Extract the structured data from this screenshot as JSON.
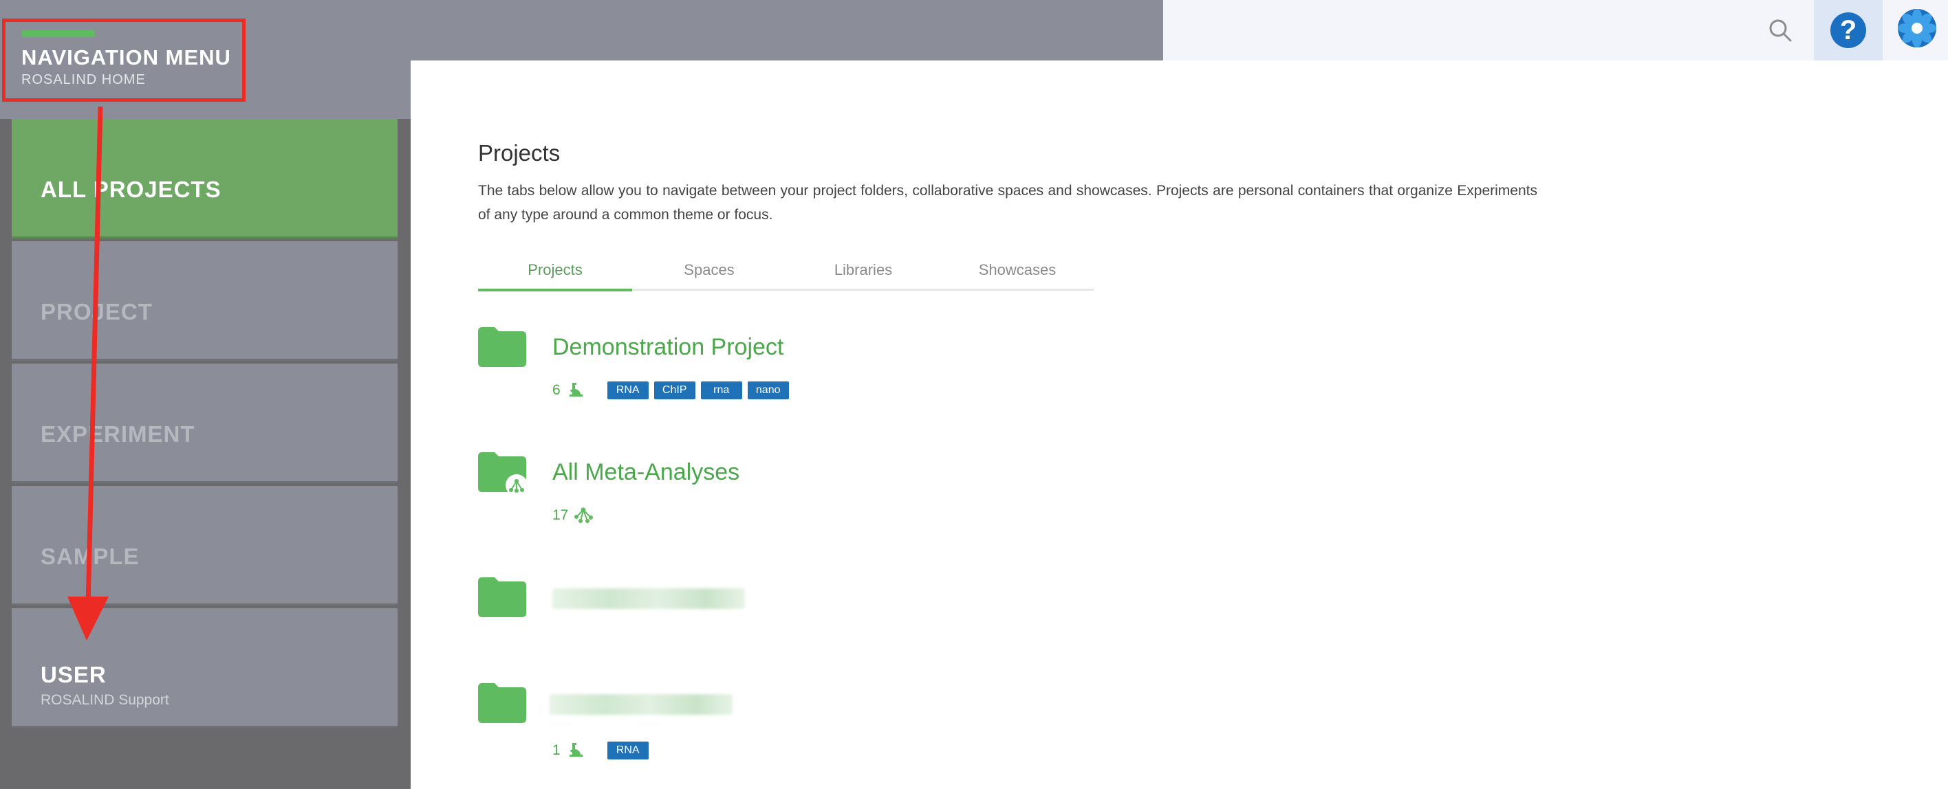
{
  "header": {
    "title": "NAVIGATION MENU",
    "subtitle": "ROSALIND HOME"
  },
  "sidebar": {
    "items": [
      {
        "label": "ALL PROJECTS",
        "active": true
      },
      {
        "label": "PROJECT"
      },
      {
        "label": "EXPERIMENT"
      },
      {
        "label": "SAMPLE"
      },
      {
        "label": "USER",
        "sub": "ROSALIND Support"
      }
    ]
  },
  "main": {
    "title": "Projects",
    "description": "The tabs below allow you to navigate between your project folders, collaborative spaces and showcases. Projects are personal containers that organize Experiments of any type around a common theme or focus.",
    "tabs": [
      "Projects",
      "Spaces",
      "Libraries",
      "Showcases"
    ],
    "active_tab": "Projects",
    "projects": [
      {
        "name": "Demonstration Project",
        "count": "6",
        "icon": "experiment-icon",
        "tags": [
          "RNA",
          "ChIP",
          "rna",
          "nano"
        ]
      },
      {
        "name": "All Meta-Analyses",
        "count": "17",
        "icon": "meta-analysis-icon",
        "tags": []
      },
      {
        "name": "",
        "count": "",
        "tags": []
      },
      {
        "name": "",
        "count": "1",
        "icon": "experiment-icon",
        "tags": [
          "RNA"
        ]
      }
    ]
  },
  "colors": {
    "accent_green": "#5fbb5f",
    "tag_blue": "#1f72b8",
    "annotation_red": "#ec2b24",
    "nav_gray": "#8b8e98"
  }
}
